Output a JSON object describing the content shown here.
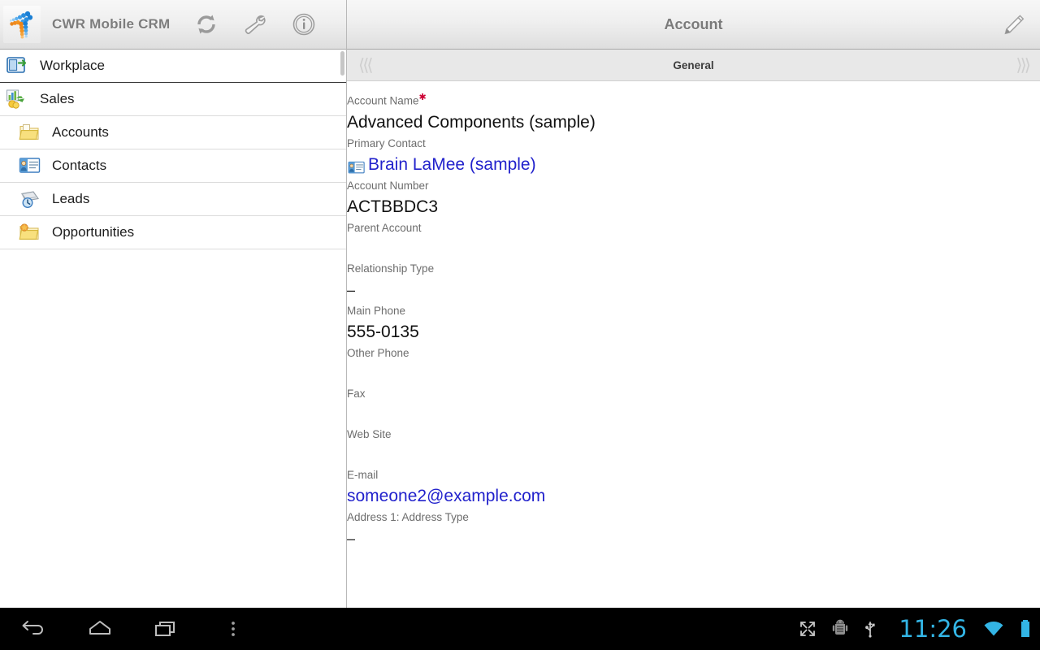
{
  "app": {
    "title": "CWR Mobile CRM",
    "logo_icon": "cwr-propeller-logo",
    "header_icons": [
      {
        "name": "sync-icon",
        "label": "Sync"
      },
      {
        "name": "wrench-icon",
        "label": "Settings"
      },
      {
        "name": "info-icon",
        "label": "About"
      }
    ]
  },
  "sidebar": {
    "items": [
      {
        "label": "Workplace",
        "icon": "workplace-icon",
        "level": "top"
      },
      {
        "label": "Sales",
        "icon": "sales-icon",
        "level": "top"
      },
      {
        "label": "Accounts",
        "icon": "folder-accounts-icon",
        "level": "sub"
      },
      {
        "label": "Contacts",
        "icon": "contact-card-icon",
        "level": "sub"
      },
      {
        "label": "Leads",
        "icon": "leads-clock-icon",
        "level": "sub"
      },
      {
        "label": "Opportunities",
        "icon": "folder-star-icon",
        "level": "sub"
      }
    ]
  },
  "content": {
    "title": "Account",
    "edit_icon": "pencil-edit-icon",
    "tab": {
      "label": "General",
      "prev_icon": "triple-chevron-left-icon",
      "next_icon": "triple-chevron-right-icon"
    },
    "fields": [
      {
        "label": "Account Name",
        "required": true,
        "value": "Advanced Components (sample)",
        "style": "text"
      },
      {
        "label": "Primary Contact",
        "required": false,
        "value": "Brain LaMee (sample)",
        "style": "link",
        "icon": "contact-card-icon"
      },
      {
        "label": "Account Number",
        "required": false,
        "value": "ACTBBDC3",
        "style": "text"
      },
      {
        "label": "Parent Account",
        "required": false,
        "value": "",
        "style": "empty"
      },
      {
        "label": "Relationship Type",
        "required": false,
        "value": "–",
        "style": "dash"
      },
      {
        "label": "Main Phone",
        "required": false,
        "value": "555-0135",
        "style": "text"
      },
      {
        "label": "Other Phone",
        "required": false,
        "value": "",
        "style": "empty"
      },
      {
        "label": "Fax",
        "required": false,
        "value": "",
        "style": "empty"
      },
      {
        "label": "Web Site",
        "required": false,
        "value": "",
        "style": "empty"
      },
      {
        "label": "E-mail",
        "required": false,
        "value": "someone2@example.com",
        "style": "link"
      },
      {
        "label": "Address 1: Address Type",
        "required": false,
        "value": "–",
        "style": "dash"
      }
    ]
  },
  "navbar": {
    "buttons": [
      {
        "name": "back-button",
        "icon": "back-arrow-icon"
      },
      {
        "name": "home-button",
        "icon": "home-icon"
      },
      {
        "name": "recents-button",
        "icon": "recents-icon"
      },
      {
        "name": "menu-button",
        "icon": "overflow-menu-icon"
      }
    ],
    "status": {
      "fullscreen_icon": "fullscreen-expand-icon",
      "android_icon": "android-debug-icon",
      "usb_icon": "usb-icon",
      "time": "11:26",
      "wifi_icon": "wifi-icon",
      "battery_icon": "battery-full-icon"
    }
  },
  "colors": {
    "link": "#2222cc",
    "required_star": "#cc0033",
    "accent_status": "#33b5e5",
    "label_gray": "#6d6d6d"
  }
}
